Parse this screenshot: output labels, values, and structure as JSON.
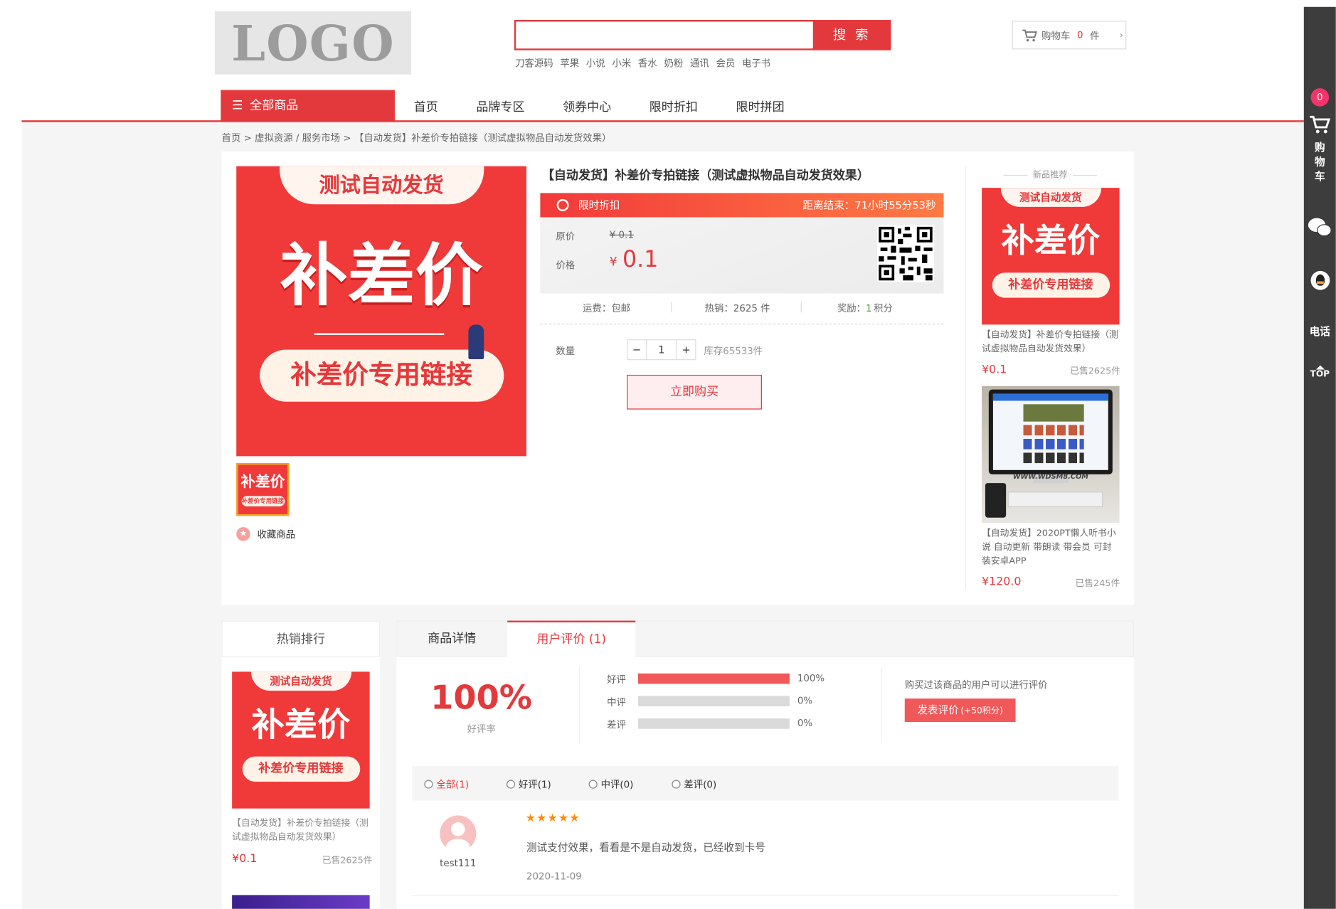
{
  "header": {
    "logo": "LOGO",
    "search_button": "搜 索",
    "search_placeholder": "",
    "hot_keywords": [
      "刀客源码",
      "苹果",
      "小说",
      "小米",
      "香水",
      "奶粉",
      "通讯",
      "会员",
      "电子书"
    ],
    "cart": {
      "label": "购物车",
      "count": "0",
      "unit": "件"
    }
  },
  "nav": {
    "all": "全部商品",
    "items": [
      "首页",
      "品牌专区",
      "领券中心",
      "限时折扣",
      "限时拼团"
    ]
  },
  "breadcrumb": "首页 > 虚拟资源 / 服务市场 > 【自动发货】补差价专拍链接（测试虚拟物品自动发货效果）",
  "banner": {
    "top": "测试自动发货",
    "big": "补差价",
    "pill": "补差价专用链接"
  },
  "product": {
    "title": "【自动发货】补差价专拍链接（测试虚拟物品自动发货效果）",
    "flash_label": "限时折扣",
    "countdown": "距离结束：71小时55分53秒",
    "orig_label": "原价",
    "orig_price": "¥ 0.1",
    "price_label": "价格",
    "price_symbol": "¥",
    "price": "0.1",
    "shipping": "运费：包邮",
    "sales": "热销：2625 件",
    "reward_label": "奖励：",
    "reward_value": "1",
    "reward_unit": "积分",
    "qty_label": "数量",
    "qty_minus": "−",
    "qty_value": "1",
    "qty_plus": "+",
    "stock": "库存65533件",
    "buy": "立即购买",
    "favorite": "收藏商品"
  },
  "recommend": {
    "title": "新品推荐",
    "items": [
      {
        "name": "【自动发货】补差价专拍链接（测试虚拟物品自动发货效果）",
        "price": "¥0.1",
        "sold": "已售2625件"
      },
      {
        "name": "【自动发货】2020PT懒人听书小说 自动更新 带朗读 带会员 可封装安卓APP",
        "price": "¥120.0",
        "sold": "已售245件"
      }
    ],
    "monitor_text": "WWW.WDSM8.COM"
  },
  "hot_rank": {
    "title": "热销排行",
    "item": {
      "name": "【自动发货】补差价专拍链接（测试虚拟物品自动发货效果）",
      "price": "¥0.1",
      "sold": "已售2625件"
    }
  },
  "tabs": {
    "detail": "商品详情",
    "reviews": "用户评价 (1)"
  },
  "reviews": {
    "rate": "100%",
    "rate_label": "好评率",
    "rows": [
      {
        "label": "好评",
        "pct": "100%",
        "fill": 1.0
      },
      {
        "label": "中评",
        "pct": "0%",
        "fill": 0
      },
      {
        "label": "差评",
        "pct": "0%",
        "fill": 0
      }
    ],
    "note": "购买过该商品的用户可以进行评价",
    "write_btn": "发表评价",
    "write_bonus": "(+50积分)",
    "filters": [
      "全部(1)",
      "好评(1)",
      "中评(0)",
      "差评(0)"
    ],
    "review": {
      "user": "test111",
      "stars": "★★★★★",
      "text": "测试支付效果，看看是不是自动发货，已经收到卡号",
      "date": "2020-11-09"
    }
  },
  "sidebar": {
    "badge": "0",
    "cart": "购物车",
    "phone": "电话",
    "top": "TOP"
  },
  "colors": {
    "accent": "#e4393c",
    "sidebar": "#3d3d3d",
    "stars": "#ff8a00"
  }
}
